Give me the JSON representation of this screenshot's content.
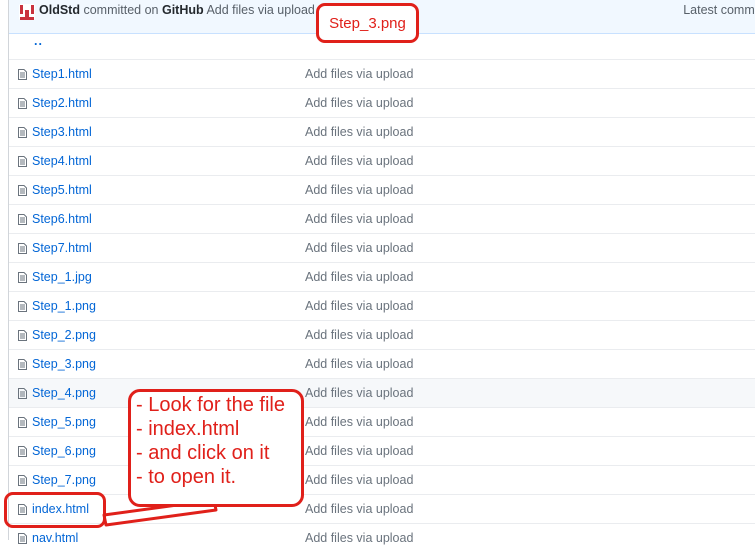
{
  "commit": {
    "author": "OldStd",
    "committed_text": "committed on",
    "platform": "GitHub",
    "message": "Add files via upload",
    "latest_label": "Latest commit"
  },
  "parent_dir": "..",
  "files": [
    {
      "name": "Step1.html",
      "message": "Add files via upload"
    },
    {
      "name": "Step2.html",
      "message": "Add files via upload"
    },
    {
      "name": "Step3.html",
      "message": "Add files via upload"
    },
    {
      "name": "Step4.html",
      "message": "Add files via upload"
    },
    {
      "name": "Step5.html",
      "message": "Add files via upload"
    },
    {
      "name": "Step6.html",
      "message": "Add files via upload"
    },
    {
      "name": "Step7.html",
      "message": "Add files via upload"
    },
    {
      "name": "Step_1.jpg",
      "message": "Add files via upload"
    },
    {
      "name": "Step_1.png",
      "message": "Add files via upload"
    },
    {
      "name": "Step_2.png",
      "message": "Add files via upload"
    },
    {
      "name": "Step_3.png",
      "message": "Add files via upload"
    },
    {
      "name": "Step_4.png",
      "message": "Add files via upload"
    },
    {
      "name": "Step_5.png",
      "message": "Add files via upload"
    },
    {
      "name": "Step_6.png",
      "message": "Add files via upload"
    },
    {
      "name": "Step_7.png",
      "message": "Add files via upload"
    },
    {
      "name": "index.html",
      "message": "Add files via upload"
    },
    {
      "name": "nav.html",
      "message": "Add files via upload"
    }
  ],
  "annotations": {
    "title": "Step_3.png",
    "lines": [
      "- Look for the file",
      "- index.html",
      "- and click on it",
      "- to open it."
    ],
    "color": "#e0201a"
  },
  "colors": {
    "link": "#0366d6",
    "muted": "#6a737d",
    "commit_bar": "#f1f8ff",
    "highlight_row": "#f6f8fa"
  }
}
